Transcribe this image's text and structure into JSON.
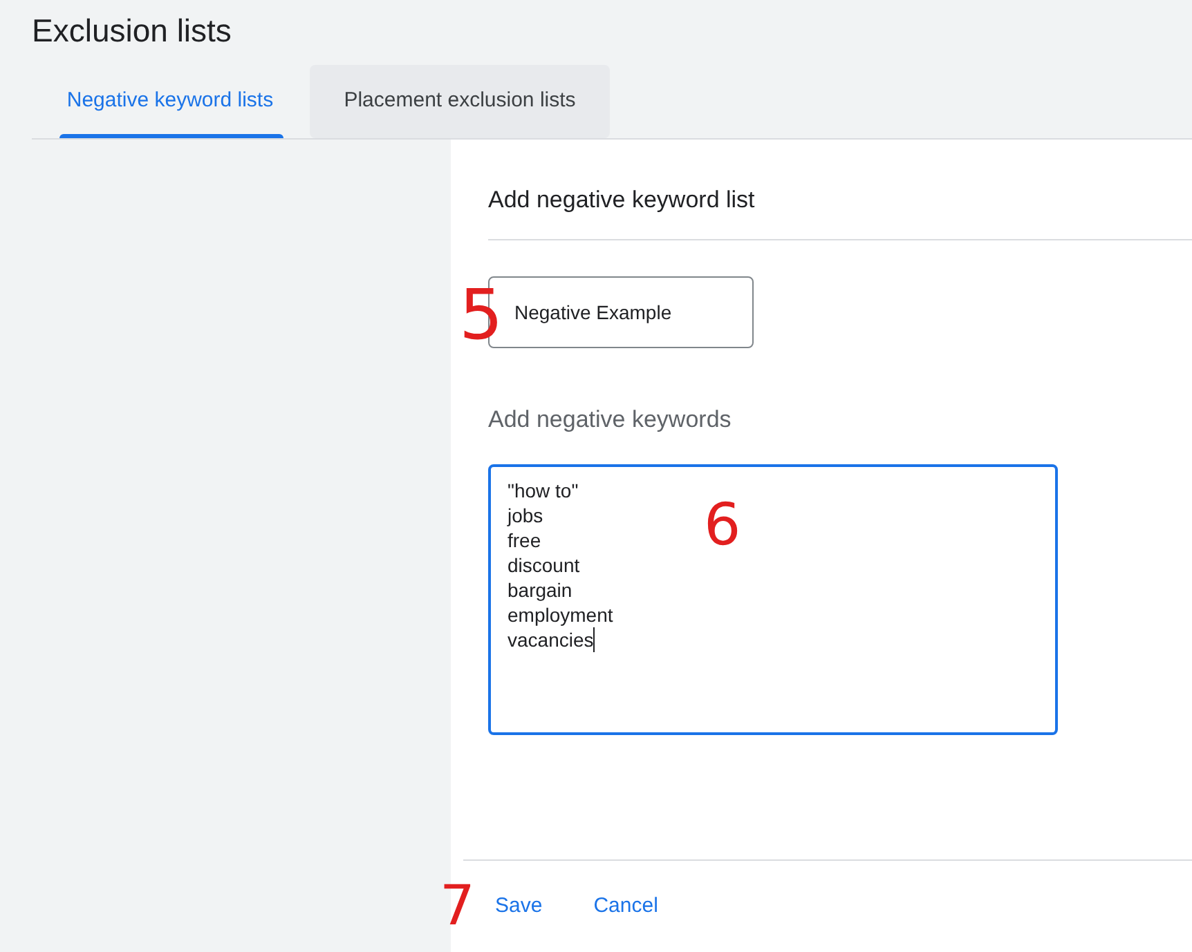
{
  "page": {
    "title": "Exclusion lists"
  },
  "tabs": [
    {
      "label": "Negative keyword lists",
      "selected": true
    },
    {
      "label": "Placement exclusion lists",
      "selected": false
    }
  ],
  "panel": {
    "title": "Add negative keyword list",
    "list_name": {
      "value": "Negative Example",
      "annotation": "5"
    },
    "keywords_label": "Add negative keywords",
    "keywords_field": {
      "focused": true,
      "lines": [
        "\"how to\"",
        "jobs",
        "free",
        "discount",
        "bargain",
        "employment",
        "vacancies"
      ],
      "annotation": "6"
    },
    "footer": {
      "annotation": "7",
      "buttons": [
        {
          "label": "Save"
        },
        {
          "label": "Cancel"
        }
      ]
    }
  }
}
